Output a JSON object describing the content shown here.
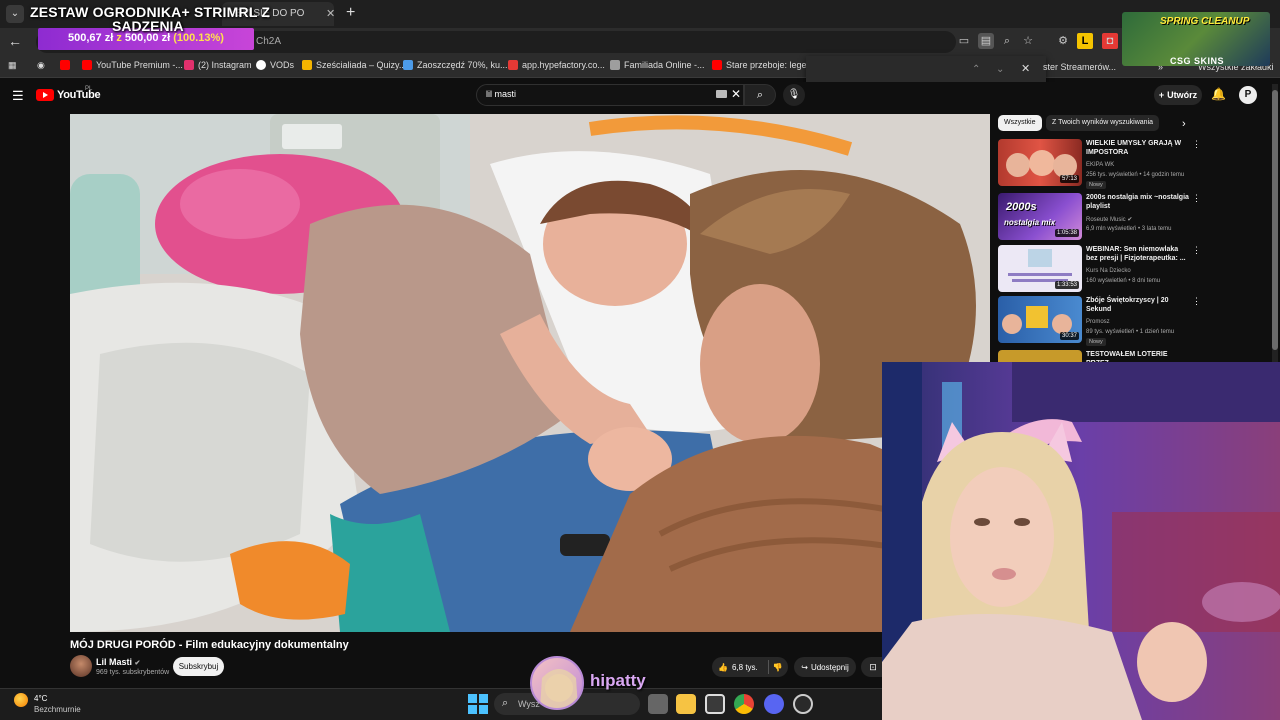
{
  "browser": {
    "tabs": [
      {
        "label": "",
        "active": false
      },
      {
        "label": "ŁEM SIĘ DO PO",
        "active": true
      }
    ],
    "address_fragment": "Ch2A",
    "bookmarks": [
      {
        "label": "YouTube Premium -...",
        "color": "#ff0000"
      },
      {
        "label": "(2) Instagram",
        "color": "#e1306c"
      },
      {
        "label": "VODs",
        "color": "#ffffff"
      },
      {
        "label": "Sześcialiada – Quizy...",
        "color": "#f4b400"
      },
      {
        "label": "Zaoszczędź 70%, ku...",
        "color": "#4c9be8"
      },
      {
        "label": "app.hypefactory.co...",
        "color": "#e53935"
      },
      {
        "label": "Familiada Online -...",
        "color": "#9e9e9e"
      },
      {
        "label": "Stare przeboje: lege...",
        "color": "#ff0000"
      }
    ],
    "bookmarks_right": [
      "ster Streamerów...",
      "Wszystkie zakładki"
    ]
  },
  "overlay": {
    "donation_title_line1": "ZESTAW OGRODNIKA+ STRIMRL Z",
    "donation_title_line2": "SADZENIA",
    "donation_raised": "500,67 zł",
    "donation_of": "z",
    "donation_goal": "500,00 zł",
    "donation_percent": "(100.13%)",
    "promo_title": "SPRING CLEANUP",
    "promo_brand": "CSG SKINS",
    "streamer_name": "hipatty"
  },
  "youtube": {
    "logo": "YouTube",
    "country": "PL",
    "search_query": "lil masti",
    "create_label": "Utwórz",
    "video": {
      "title": "MÓJ DRUGI PORÓD - Film edukacyjny dokumentalny",
      "channel": "Lil Masti",
      "subscribers": "969 tys. subskrybentów",
      "subscribe_label": "Subskrybuj",
      "likes": "6,8 tys.",
      "share_label": "Udostępnij"
    },
    "chips": [
      "Wszystkie",
      "Z Twoich wyników wyszukiwania"
    ],
    "recommendations": [
      {
        "title": "WIELKIE UMYSŁY GRAJĄ W IMPOSTORA",
        "channel": "EKIPA WK",
        "meta": "256 tys. wyświetleń • 14 godzin temu",
        "badge": "Nowy",
        "duration": "57:13",
        "thumb_color": "#c0392b"
      },
      {
        "title": "2000s nostalgia mix ~nostalgia playlist",
        "channel": "Roseute Music",
        "meta": "6,9 mln wyświetleń • 3 lata temu",
        "badge": "",
        "duration": "1:05:38",
        "thumb_color": "#6a3fa0",
        "thumb_text": "2000s nostalgia mix"
      },
      {
        "title": "WEBINAR: Sen niemowlaka bez presji | Fizjoterapeutka: ...",
        "channel": "Kurs Na Dziecko",
        "meta": "160 wyświetleń • 8 dni temu",
        "badge": "",
        "duration": "1:33:53",
        "thumb_color": "#e8e3f3"
      },
      {
        "title": "Zbóje Świętokrzyscy | 20 Sekund",
        "channel": "Promosz",
        "meta": "89 tys. wyświetleń • 1 dzień temu",
        "badge": "Nowy",
        "duration": "30:37",
        "thumb_color": "#2f6fb8"
      },
      {
        "title": "TESTOWAŁEM LOTERIE PRZEZ",
        "channel": "",
        "meta": "",
        "badge": "",
        "duration": "",
        "thumb_color": "#c79a2a"
      }
    ]
  },
  "taskbar": {
    "temperature": "4°C",
    "weather": "Bezchmurnie",
    "search_placeholder": "Wysz"
  }
}
